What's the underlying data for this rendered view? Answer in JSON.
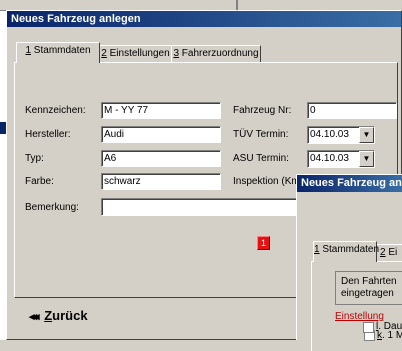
{
  "main_window": {
    "title": "Neues Fahrzeug anlegen",
    "tabs": [
      {
        "key": "1",
        "label": " Stammdaten"
      },
      {
        "key": "2",
        "label": " Einstellungen"
      },
      {
        "key": "3",
        "label": " Fahrerzuordnung"
      }
    ],
    "fields": {
      "kennzeichen": {
        "label": "Kennzeichen:",
        "value": "M - YY 77"
      },
      "hersteller": {
        "label": "Hersteller:",
        "value": "Audi"
      },
      "typ": {
        "label": "Typ:",
        "value": "A6"
      },
      "farbe": {
        "label": "Farbe:",
        "value": "schwarz"
      },
      "bemerkung": {
        "label": "Bemerkung:",
        "value": ""
      },
      "fahrzeug_nr": {
        "label": "Fahrzeug Nr:",
        "value": "0"
      },
      "tuev": {
        "label": "TÜV Termin:",
        "value": "04.10.03"
      },
      "asu": {
        "label": "ASU Termin:",
        "value": "04.10.03"
      },
      "inspektion": {
        "label": "Inspektion (Km"
      }
    },
    "red_badge": "1",
    "back_arrows": "◂◂◂",
    "back_key": "Z",
    "back_rest": "urück"
  },
  "overlay_window": {
    "title": "Neues Fahrzeug anlegen",
    "tabs": [
      {
        "key": "1",
        "label": " Stammdaten"
      },
      {
        "key": "2",
        "label": " Ei"
      }
    ],
    "info_line1": "Den Fahrten",
    "info_line2": "eingetragen",
    "link": "Einstellung",
    "check1_key": "k",
    "check1_rest": ". 1 Mi",
    "check2_key": "l",
    "check2_rest": ". Daue"
  },
  "colors": {
    "title_start": "#0a246a",
    "title_end": "#3a6ea5",
    "badge": "#e81010",
    "link": "#c00000"
  }
}
